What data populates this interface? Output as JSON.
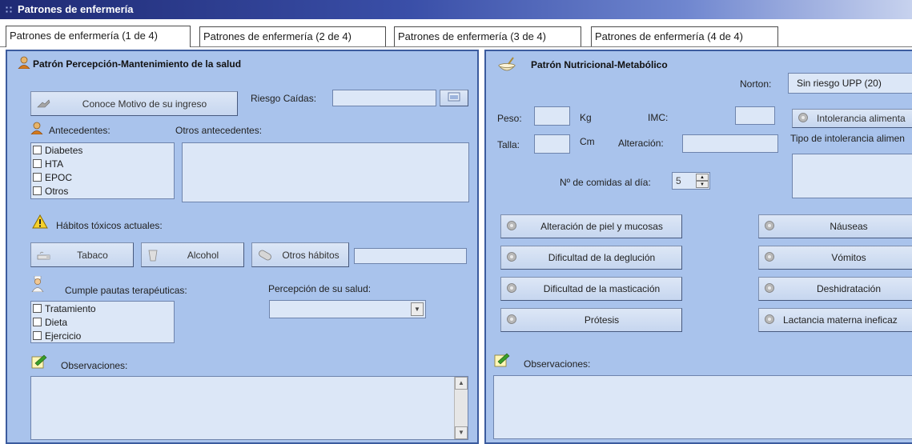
{
  "window": {
    "title": "Patrones de enfermería"
  },
  "tabs": [
    {
      "label": "Patrones de enfermería (1 de 4)"
    },
    {
      "label": "Patrones de enfermería (2 de 4)"
    },
    {
      "label": "Patrones de enfermería (3 de 4)"
    },
    {
      "label": "Patrones de enfermería (4 de 4)"
    }
  ],
  "left": {
    "title": "Patrón Percepción-Mantenimiento de la salud",
    "motivo_button": "Conoce Motivo de su ingreso",
    "riesgo_label": "Riesgo Caídas:",
    "riesgo_value": "",
    "antecedentes_label": "Antecedentes:",
    "antecedentes_items": [
      "Diabetes",
      "HTA",
      "EPOC",
      "Otros"
    ],
    "otros_antecedentes_label": "Otros antecedentes:",
    "habitos_label": "Hábitos tóxicos actuales:",
    "tabaco_button": "Tabaco",
    "alcohol_button": "Alcohol",
    "otros_habitos_button": "Otros hábitos",
    "otros_habitos_value": "",
    "pautas_label": "Cumple pautas terapéuticas:",
    "pautas_items": [
      "Tratamiento",
      "Dieta",
      "Ejercicio"
    ],
    "percepcion_label": "Percepción de su salud:",
    "percepcion_value": "",
    "observaciones_label": "Observaciones:"
  },
  "right": {
    "title": "Patrón Nutricional-Metabólico",
    "norton_label": "Norton:",
    "norton_value": "Sin riesgo UPP (20)",
    "peso_label": "Peso:",
    "kg_unit": "Kg",
    "imc_label": "IMC:",
    "intolerancia_button": "Intolerancia alimenta",
    "talla_label": "Talla:",
    "cm_unit": "Cm",
    "alteracion_label": "Alteración:",
    "tipo_intolerancia_label": "Tipo de intolerancia alimen",
    "comidas_label": "Nº de comidas al día:",
    "comidas_value": "5",
    "buttons_left": [
      "Alteración de piel y mucosas",
      "Dificultad de la deglución",
      "Dificultad de la masticación",
      "Prótesis"
    ],
    "buttons_right": [
      "Náuseas",
      "Vómitos",
      "Deshidratación",
      "Lactancia materna ineficaz"
    ],
    "observaciones_label": "Observaciones:"
  },
  "colors": {
    "panel_bg": "#a9c3ec",
    "panel_border": "#3b5b9e",
    "field_bg": "#dce7f7",
    "title_gradient_start": "#1f2a74"
  },
  "icons": [
    "person-icon",
    "warning-icon",
    "notepad-icon",
    "bowl-icon",
    "gear-icon",
    "cigarette-icon",
    "glass-icon",
    "pill-icon",
    "nurse-icon",
    "calendar-icon"
  ]
}
